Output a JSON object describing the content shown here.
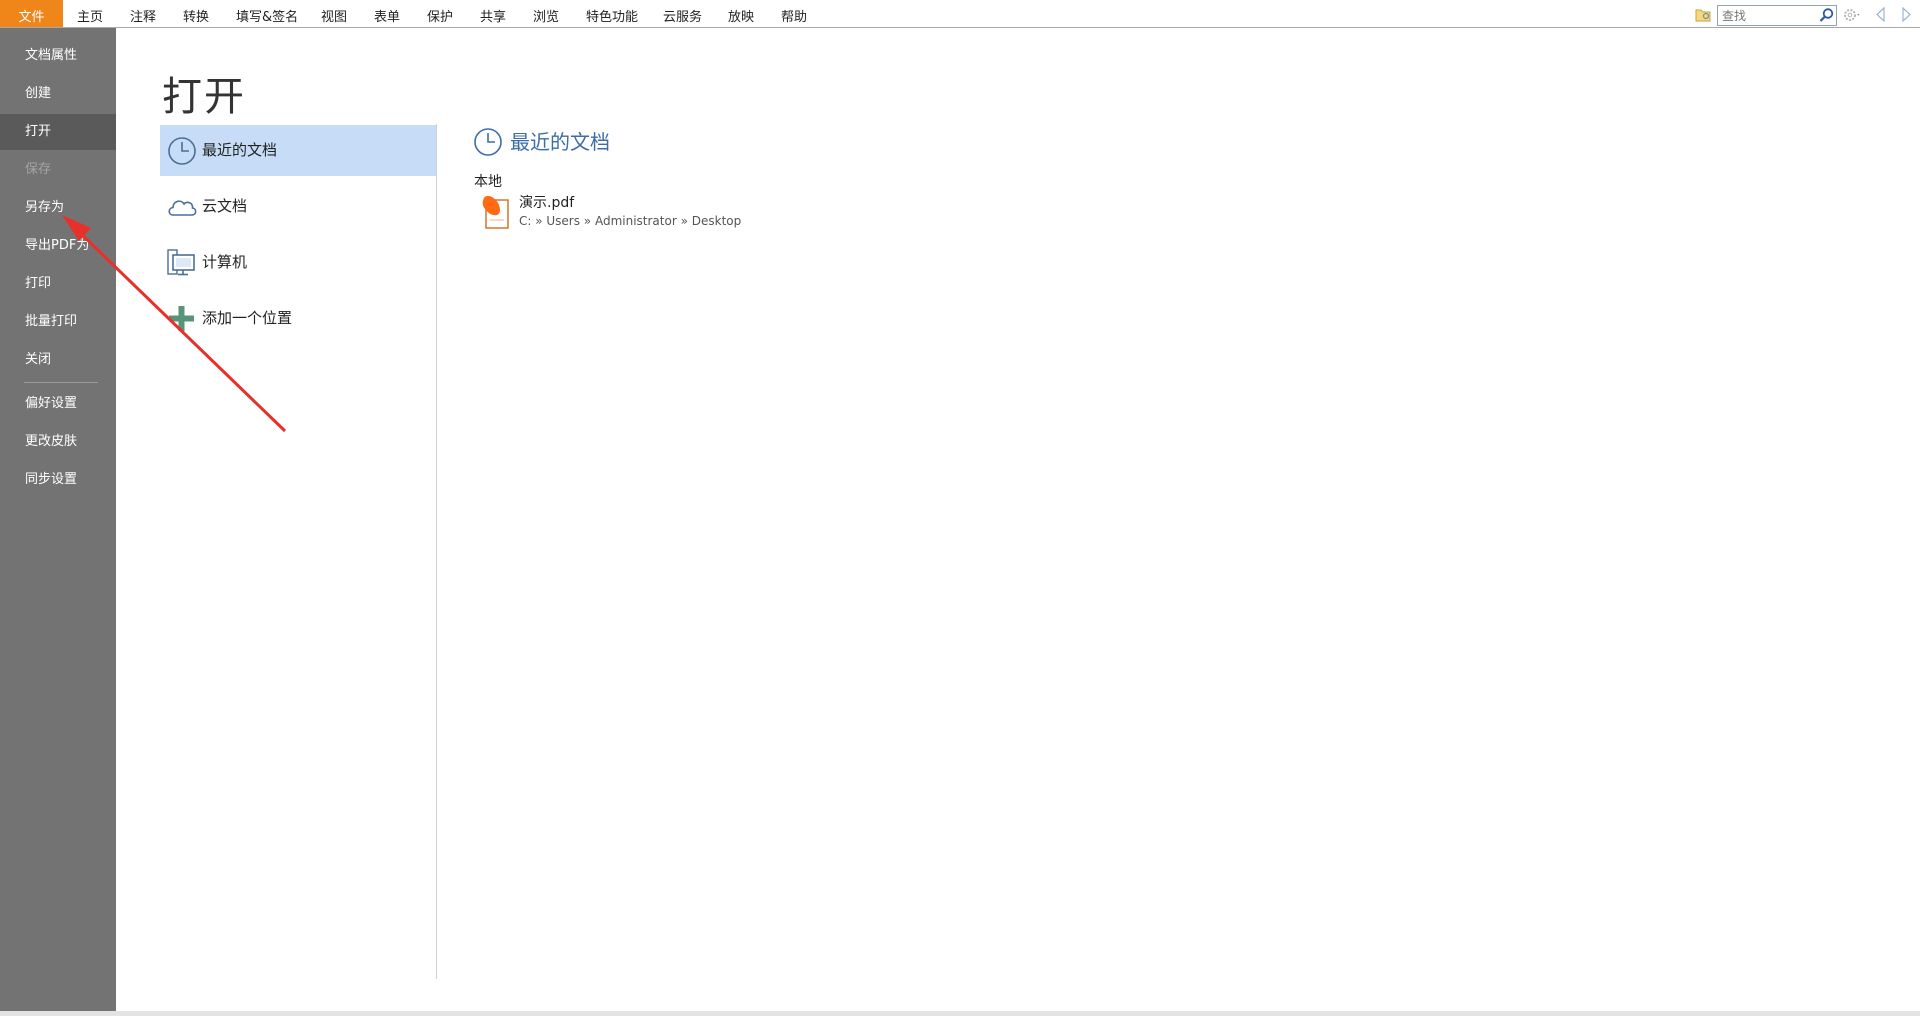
{
  "menubar": {
    "items": [
      {
        "label": "文件",
        "active": true
      },
      {
        "label": "主页"
      },
      {
        "label": "注释"
      },
      {
        "label": "转换"
      },
      {
        "label": "填写&签名"
      },
      {
        "label": "视图"
      },
      {
        "label": "表单"
      },
      {
        "label": "保护"
      },
      {
        "label": "共享"
      },
      {
        "label": "浏览"
      },
      {
        "label": "特色功能"
      },
      {
        "label": "云服务"
      },
      {
        "label": "放映"
      },
      {
        "label": "帮助"
      }
    ],
    "search_placeholder": "查找",
    "icons": [
      "folder-search-icon",
      "search-icon",
      "settings-icon",
      "nav-back-icon",
      "nav-forward-icon"
    ]
  },
  "file_menu": {
    "items": [
      {
        "label": "文档属性"
      },
      {
        "label": "创建"
      },
      {
        "label": "打开",
        "selected": true
      },
      {
        "label": "保存",
        "disabled": true
      },
      {
        "label": "另存为"
      },
      {
        "label": "导出PDF为"
      },
      {
        "label": "打印"
      },
      {
        "label": "批量打印"
      },
      {
        "label": "关闭"
      },
      {
        "label": "偏好设置"
      },
      {
        "label": "更改皮肤"
      },
      {
        "label": "同步设置"
      }
    ]
  },
  "main": {
    "title": "打开",
    "places": [
      {
        "label": "最近的文档",
        "icon": "clock-icon",
        "selected": true
      },
      {
        "label": "云文档",
        "icon": "cloud-icon"
      },
      {
        "label": "计算机",
        "icon": "computer-icon"
      },
      {
        "label": "添加一个位置",
        "icon": "plus-icon"
      }
    ],
    "recent": {
      "header": "最近的文档",
      "group_label": "本地",
      "files": [
        {
          "name": "演示.pdf",
          "path": "C: » Users » Administrator » Desktop"
        }
      ]
    }
  },
  "colors": {
    "accent": "#f08519",
    "file_menu_bg": "#737373",
    "selected_place_bg": "#c7ddf7",
    "header_blue": "#3c6ea5",
    "annotation_red": "#e8302a"
  }
}
